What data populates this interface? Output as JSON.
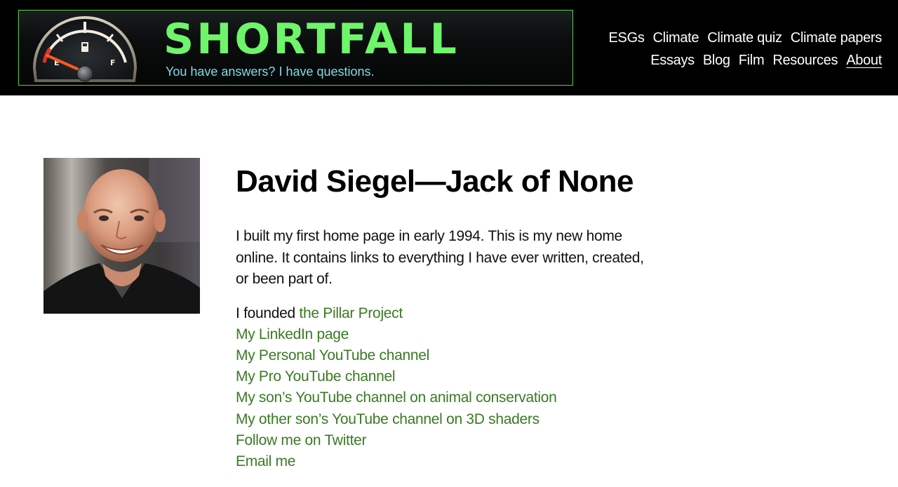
{
  "banner": {
    "title": "SHORTFALL",
    "tagline": "You have answers? I have questions.",
    "gauge_empty_label": "E",
    "gauge_full_label": "F",
    "title_color": "#6ef56a",
    "tagline_color": "#7fdbe6",
    "border_color": "#5fcf4f"
  },
  "nav": {
    "row1": [
      "ESGs",
      "Climate",
      "Climate quiz",
      "Climate papers"
    ],
    "row2": [
      "Essays",
      "Blog",
      "Film",
      "Resources",
      "About"
    ],
    "active": "About"
  },
  "main": {
    "title": "David Siegel—Jack of None",
    "intro": "I built my first home page in early 1994. This is my new home online. It contains links to everything I have ever written, created, or been part of.",
    "founded_prefix": "I founded ",
    "links": [
      "the Pillar Project",
      "My LinkedIn page",
      "My Personal YouTube channel",
      "My Pro YouTube channel",
      "My son’s YouTube channel on animal conservation",
      "My other son’s YouTube channel on 3D shaders",
      "Follow me on Twitter",
      "Email me"
    ]
  },
  "colors": {
    "link": "#3a7a24",
    "header_bg": "#000000"
  }
}
